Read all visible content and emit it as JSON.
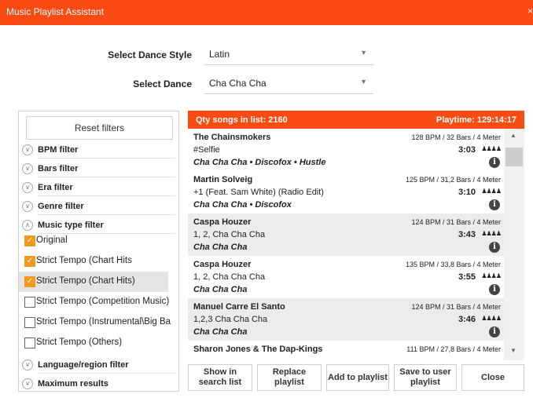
{
  "app": {
    "title": "Music Playlist Assistant",
    "close_glyph": "×"
  },
  "dance_style": {
    "label": "Select Dance Style",
    "value": "Latin"
  },
  "dance": {
    "label": "Select Dance",
    "value": "Cha Cha Cha"
  },
  "filters": {
    "reset_label": "Reset filters",
    "sections": [
      {
        "label": "BPM filter",
        "expanded": false
      },
      {
        "label": "Bars filter",
        "expanded": false
      },
      {
        "label": "Era filter",
        "expanded": false
      },
      {
        "label": "Genre filter",
        "expanded": false
      },
      {
        "label": "Music type filter",
        "expanded": true
      },
      {
        "label": "Language/region filter",
        "expanded": false
      },
      {
        "label": "Maximum results",
        "expanded": false
      }
    ],
    "music_types": [
      {
        "label": "Original",
        "checked": true
      },
      {
        "label": "Strict Tempo (Chart Hits",
        "checked": true
      },
      {
        "label": "Strict Tempo (Chart Hits)",
        "checked": true
      },
      {
        "label": "Strict Tempo (Competition Music)",
        "checked": false
      },
      {
        "label": "Strict Tempo (Instrumental\\Big Ba",
        "checked": false
      },
      {
        "label": "Strict Tempo (Others)",
        "checked": false
      }
    ]
  },
  "playlist": {
    "qty_label": "Qty songs in list: 2160",
    "playtime_label": "Playtime: 129:14:17",
    "songs": [
      {
        "artist": "The Chainsmokers",
        "title": "#Selfie",
        "dances": "Cha Cha Cha • Discofox • Hustle",
        "bpm": "128 BPM / 32 Bars / 4 Meter",
        "duration": "3:03"
      },
      {
        "artist": "Martin Solveig",
        "title": "+1 (Feat. Sam White) (Radio Edit)",
        "dances": "Cha Cha Cha • Discofox",
        "bpm": "125 BPM / 31,2 Bars / 4 Meter",
        "duration": "3:10"
      },
      {
        "artist": "Caspa Houzer",
        "title": "1, 2, Cha Cha Cha",
        "dances": "Cha Cha Cha",
        "bpm": "124 BPM / 31 Bars / 4 Meter",
        "duration": "3:43"
      },
      {
        "artist": "Caspa Houzer",
        "title": "1, 2, Cha Cha Cha",
        "dances": "Cha Cha Cha",
        "bpm": "135 BPM / 33,8 Bars / 4 Meter",
        "duration": "3:55"
      },
      {
        "artist": "Manuel Carre El Santo",
        "title": "1,2,3 Cha Cha Cha",
        "dances": "Cha Cha Cha",
        "bpm": "124 BPM / 31 Bars / 4 Meter",
        "duration": "3:46"
      },
      {
        "artist": "Sharon Jones & The Dap-Kings",
        "title": "",
        "dances": "",
        "bpm": "111 BPM / 27,8 Bars / 4 Meter",
        "duration": ""
      }
    ]
  },
  "buttons": {
    "show_in_search": "Show in search list",
    "replace": "Replace playlist",
    "add": "Add to playlist",
    "save": "Save to user playlist",
    "close": "Close"
  },
  "colors": {
    "accent": "#fa4b12",
    "checkbox": "#f39a1e"
  },
  "icons": {
    "dropdown": "chevron-down-icon",
    "info": "info-icon",
    "dancers": "dancers-icon"
  }
}
